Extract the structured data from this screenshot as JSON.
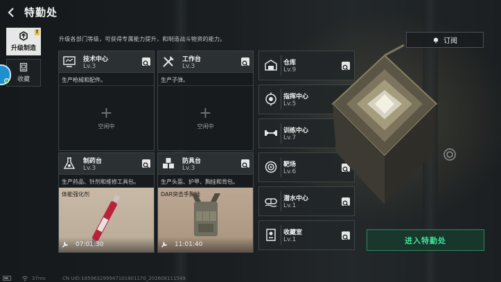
{
  "header": {
    "title": "特勤处"
  },
  "sidenav": [
    {
      "label": "升级制造",
      "badge": "!",
      "icon": "upgrade-icon"
    },
    {
      "label": "收藏",
      "icon": "collection-icon"
    }
  ],
  "description": "升级各部门等级，可获得专属能力提升，和制造战斗物资的能力。",
  "subscribe": {
    "label": "订阅",
    "icon": "bell-icon"
  },
  "cards": [
    {
      "name": "技术中心",
      "level": "Lv.3",
      "desc": "生产枪械和配件。",
      "state": "idle",
      "idle_label": "空闲中",
      "icon": "monitor-icon"
    },
    {
      "name": "工作台",
      "level": "Lv.3",
      "desc": "生产子弹。",
      "state": "idle",
      "idle_label": "空闲中",
      "icon": "tools-icon"
    },
    {
      "name": "制药台",
      "level": "Lv.3",
      "desc": "生产药品、针剂和维修工具包。",
      "state": "producing",
      "item": "体能强化剂",
      "timer": "07:01:30",
      "icon": "flask-icon"
    },
    {
      "name": "防具台",
      "level": "Lv.3",
      "desc": "生产头盔、护甲、胸挂和背包。",
      "state": "producing",
      "item": "DAR突击手胸挂",
      "timer": "11:01:40",
      "icon": "boxes-icon"
    }
  ],
  "slots": [
    {
      "name": "仓库",
      "level": "Lv.9",
      "icon": "warehouse-icon"
    },
    {
      "name": "指挥中心",
      "level": "Lv.5",
      "icon": "command-icon"
    },
    {
      "name": "训练中心",
      "level": "Lv.7",
      "icon": "dumbbell-icon"
    },
    {
      "name": "靶场",
      "level": "Lv.6",
      "icon": "target-icon"
    },
    {
      "name": "潜水中心",
      "level": "Lv.1",
      "icon": "diving-icon"
    },
    {
      "name": "收藏室",
      "level": "Lv.1",
      "icon": "display-case-icon"
    }
  ],
  "enter_button": "进入特勤处",
  "footer": {
    "ping": "37ms",
    "uid": "CN UID:185963299947101601170_202608111549"
  },
  "colors": {
    "accent_green": "#3fe39a",
    "badge_yellow": "#e5c440",
    "panel": "#2b3033"
  }
}
